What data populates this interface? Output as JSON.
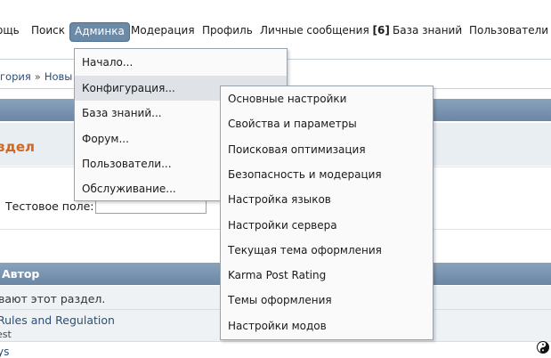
{
  "nav": {
    "items": [
      "ощь",
      "Поиск",
      "Админка",
      "Модерация",
      "Профиль",
      "Личные сообщения",
      "База знаний",
      "Пользователи"
    ],
    "pm_count": "[6]"
  },
  "breadcrumb": {
    "part1": "гория",
    "separator": "»",
    "part2": "Новы"
  },
  "section_title": "здел",
  "test_field": {
    "label": "Тестовое поле:",
    "value": ""
  },
  "author_header": "Автор",
  "rows": {
    "row1_text": "вают этот раздел.",
    "row2_link": "Rules and Regulation",
    "row2_sub": "est",
    "row3_text": "ys"
  },
  "admin_menu": {
    "items": [
      "Начало...",
      "Конфигурация...",
      "База знаний...",
      "Форум...",
      "Пользователи...",
      "Обслуживание..."
    ],
    "highlighted": "Конфигурация..."
  },
  "config_menu": {
    "items": [
      "Основные настройки",
      "Свойства и параметры",
      "Поисковая оптимизация",
      "Безопасность и модерация",
      "Настройка языков",
      "Настройки сервера",
      "Текущая тема оформления",
      "Karma Post Rating",
      "Темы оформления",
      "Настройки модов"
    ]
  },
  "colors": {
    "accent_tab": "#6b8aa8",
    "header_bar": "#7a95b1",
    "section_title": "#d2671f",
    "link": "#2a4f78"
  },
  "icons": {
    "corner": "yin-yang-icon"
  }
}
